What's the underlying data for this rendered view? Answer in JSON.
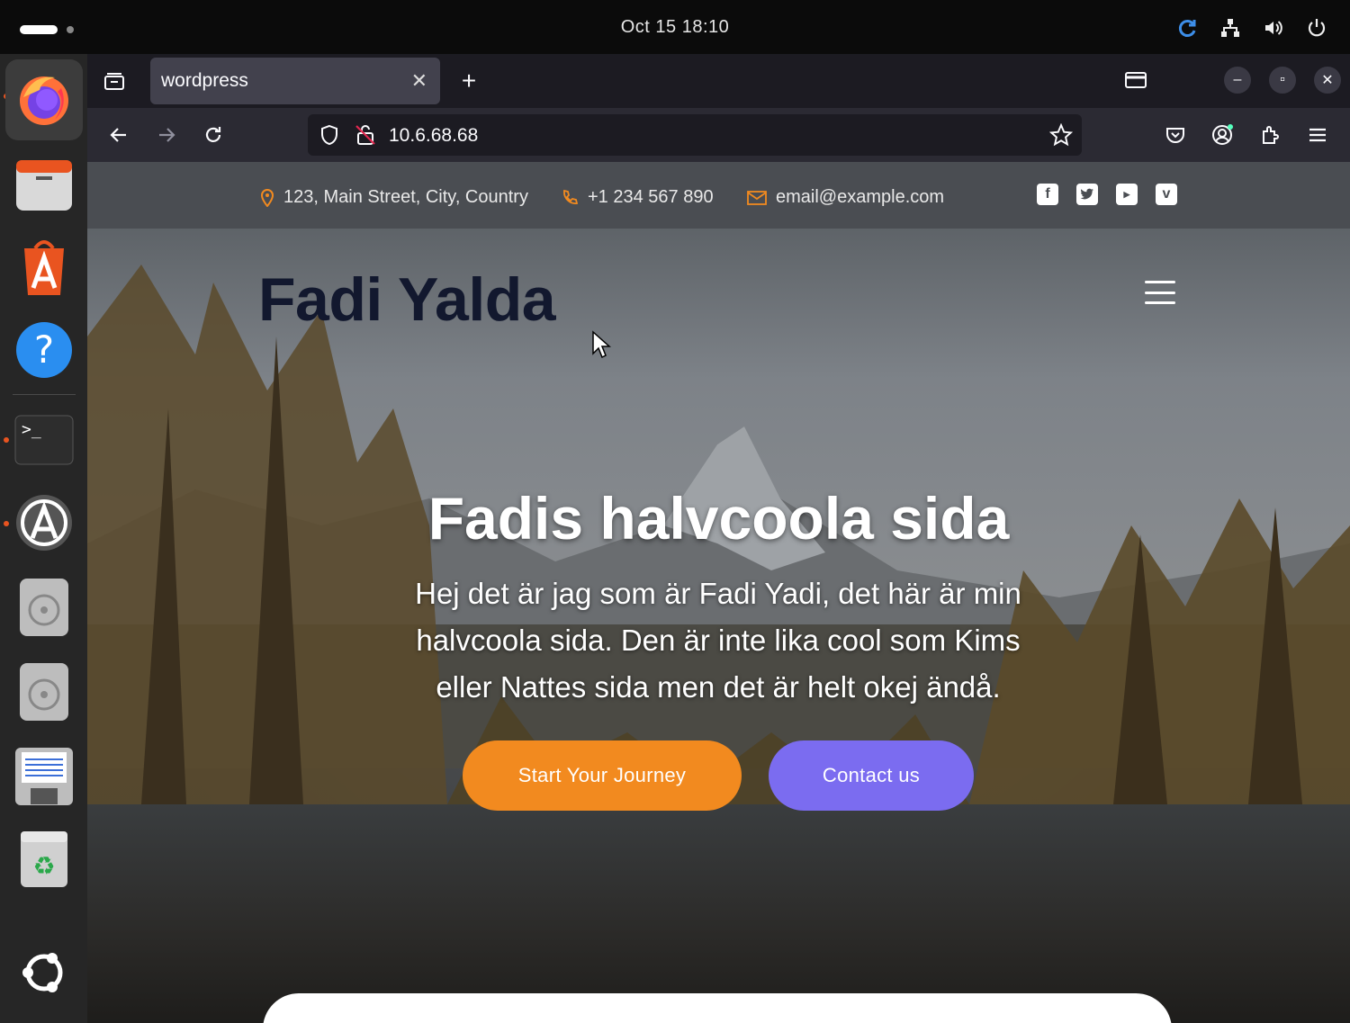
{
  "topbar": {
    "clock": "Oct 15  18:10",
    "tray_icons": [
      "refresh-icon",
      "network-icon",
      "volume-icon",
      "power-icon"
    ]
  },
  "dock": {
    "apps": [
      "firefox",
      "files",
      "app-center",
      "help",
      "terminal",
      "software-updater",
      "disc",
      "disc",
      "save",
      "trash",
      "ubuntu"
    ]
  },
  "browser": {
    "tab_title": "wordpress",
    "url": "10.6.68.68"
  },
  "site": {
    "info": {
      "address": "123, Main Street, City, Country",
      "phone": "+1 234 567 890",
      "email": "email@example.com"
    },
    "social": [
      "facebook",
      "twitter",
      "youtube",
      "vimeo"
    ],
    "brand": "Fadi Yalda",
    "headline": "Fadis halvcoola sida",
    "lead": "Hej det är jag som är Fadi Yadi, det här är min halvcoola sida. Den är inte lika cool som Kims eller Nattes sida men det är helt okej ändå.",
    "btn_primary": "Start Your Journey",
    "btn_secondary": "Contact us",
    "colors": {
      "orange": "#f28a1f",
      "purple": "#7b6cf0",
      "brand": "#12182e"
    }
  }
}
